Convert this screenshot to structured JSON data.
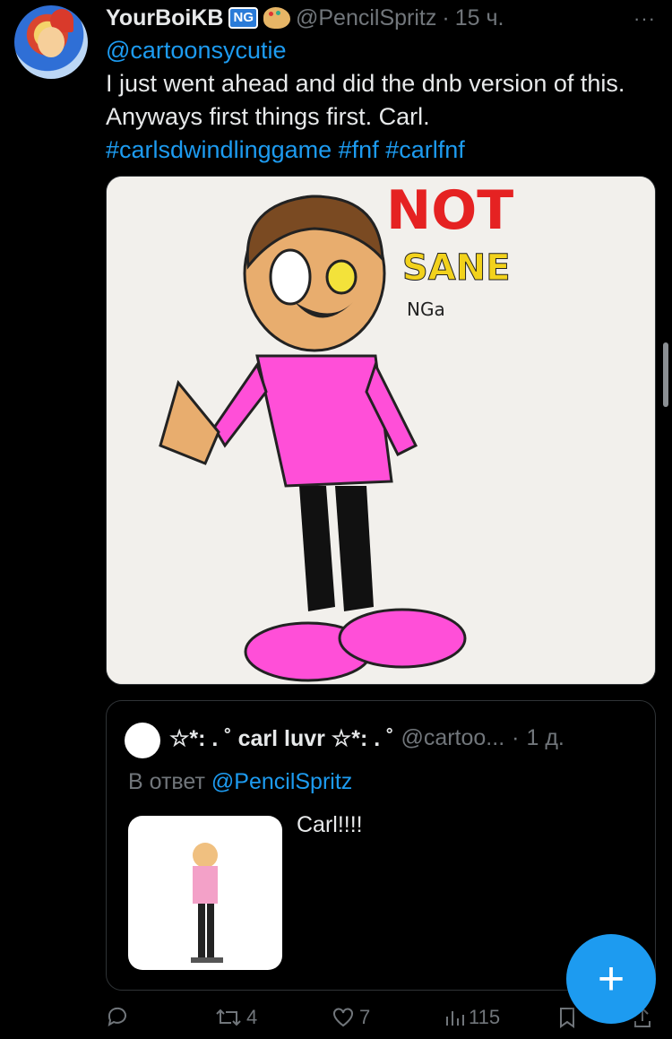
{
  "tweet": {
    "author_name": "YourBoiKB",
    "badge": "NG",
    "handle": "@PencilSpritz",
    "separator": "·",
    "time": "15 ч.",
    "more": "···",
    "reply_to": "@cartoonsycutie",
    "text": "I just went ahead and did the dnb version of this. Anyways first things first. Carl.",
    "hashtags": [
      "#carlsdwindlinggame",
      "#fnf",
      "#carlfnf"
    ]
  },
  "media": {
    "drawing_text_top": "NOT",
    "drawing_text_bottom": "SANE",
    "signature": "NGa"
  },
  "quote": {
    "author_name": "☆*: . ˚ carl luvr ☆*: . ˚",
    "handle": "@cartoo...",
    "separator": "·",
    "time": "1 д.",
    "reply_prefix": "В ответ",
    "reply_handle": "@PencilSpritz",
    "text": "Carl!!!!"
  },
  "actions": {
    "reply_count": "",
    "retweet_count": "4",
    "like_count": "7",
    "views_count": "115"
  },
  "fab_label": "+",
  "colors": {
    "background": "#000000",
    "text": "#e7e9ea",
    "muted": "#71767b",
    "accent": "#1d9bf0"
  },
  "icons": {
    "reply": "reply-icon",
    "retweet": "retweet-icon",
    "like": "heart-icon",
    "views": "views-icon",
    "bookmark": "bookmark-icon",
    "share": "share-icon"
  }
}
